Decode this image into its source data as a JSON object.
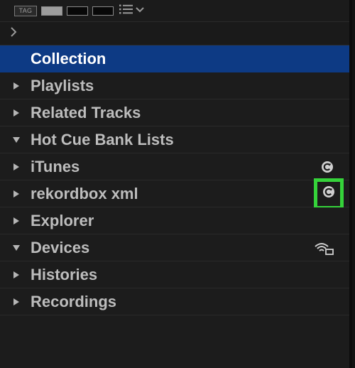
{
  "toolbar": {
    "tag_label": "TAG",
    "list_mode_icon": "list-icon",
    "dropdown_icon": "chevron-down-icon",
    "swatch_colors": [
      "#9d9d9d",
      "#080808",
      "#080808"
    ]
  },
  "breadcrumb": {
    "expand_icon": "chevron-right-icon"
  },
  "tree": {
    "items": [
      {
        "label": "Collection",
        "state": "selected"
      },
      {
        "label": "Playlists",
        "state": "collapsed"
      },
      {
        "label": "Related Tracks",
        "state": "collapsed"
      },
      {
        "label": "Hot Cue Bank Lists",
        "state": "expanded"
      },
      {
        "label": "iTunes",
        "state": "collapsed",
        "icon": "sync-icon"
      },
      {
        "label": "rekordbox xml",
        "state": "collapsed",
        "icon": "sync-icon",
        "highlighted": true
      },
      {
        "label": "Explorer",
        "state": "collapsed"
      },
      {
        "label": "Devices",
        "state": "expanded",
        "icon": "wireless-device-icon"
      },
      {
        "label": "Histories",
        "state": "collapsed"
      },
      {
        "label": "Recordings",
        "state": "collapsed"
      }
    ]
  },
  "colors": {
    "selection": "#0d3a84",
    "highlight": "#35d33a",
    "background": "#1c1c1c",
    "text": "#bdbdbd"
  }
}
